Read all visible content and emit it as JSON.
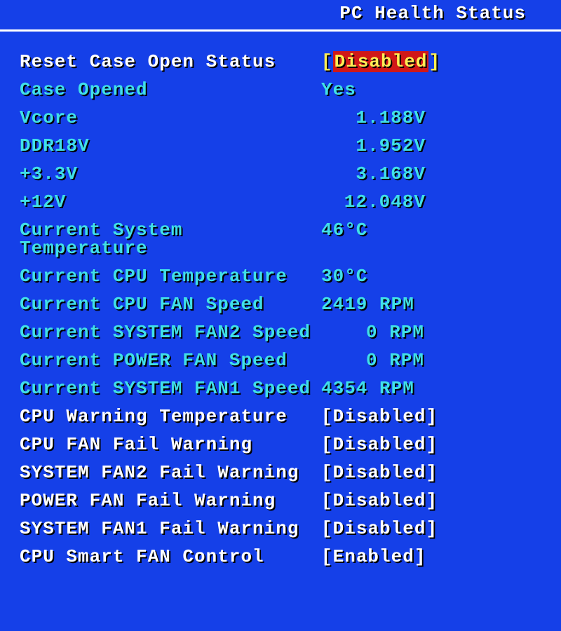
{
  "header": {
    "title": "PC Health Status"
  },
  "rows": [
    {
      "label": "Reset Case Open Status",
      "value": "Disabled",
      "labelClass": "white",
      "valueClass": "yellow",
      "bracketed": true,
      "highlighted": true,
      "interactable": true
    },
    {
      "label": "Case Opened",
      "value": "Yes",
      "labelClass": "cyan",
      "valueClass": "cyan",
      "bracketed": false,
      "interactable": false,
      "align": "left"
    },
    {
      "label": "Vcore",
      "value": "1.188V",
      "labelClass": "cyan",
      "valueClass": "cyan",
      "bracketed": false,
      "interactable": false,
      "align": "right"
    },
    {
      "label": "DDR18V",
      "value": "1.952V",
      "labelClass": "cyan",
      "valueClass": "cyan",
      "bracketed": false,
      "interactable": false,
      "align": "right"
    },
    {
      "label": "+3.3V",
      "value": "3.168V",
      "labelClass": "cyan",
      "valueClass": "cyan",
      "bracketed": false,
      "interactable": false,
      "align": "right"
    },
    {
      "label": "+12V",
      "value": "12.048V",
      "labelClass": "cyan",
      "valueClass": "cyan",
      "bracketed": false,
      "interactable": false,
      "align": "right"
    },
    {
      "label": "Current System Temperature",
      "value": "46°C",
      "labelClass": "cyan",
      "valueClass": "cyan",
      "bracketed": false,
      "interactable": false,
      "align": "left"
    },
    {
      "label": "Current CPU Temperature",
      "value": "30°C",
      "labelClass": "cyan",
      "valueClass": "cyan",
      "bracketed": false,
      "interactable": false,
      "align": "left"
    },
    {
      "label": "Current CPU FAN Speed",
      "value": "2419 RPM",
      "labelClass": "cyan",
      "valueClass": "cyan",
      "bracketed": false,
      "interactable": false,
      "align": "left"
    },
    {
      "label": "Current SYSTEM FAN2 Speed",
      "value": "0 RPM",
      "labelClass": "cyan",
      "valueClass": "cyan",
      "bracketed": false,
      "interactable": false,
      "align": "rpm"
    },
    {
      "label": "Current POWER FAN Speed",
      "value": "0 RPM",
      "labelClass": "cyan",
      "valueClass": "cyan",
      "bracketed": false,
      "interactable": false,
      "align": "rpm"
    },
    {
      "label": "Current SYSTEM FAN1 Speed",
      "value": "4354 RPM",
      "labelClass": "cyan",
      "valueClass": "cyan",
      "bracketed": false,
      "interactable": false,
      "align": "left"
    },
    {
      "label": "CPU Warning Temperature",
      "value": "Disabled",
      "labelClass": "white",
      "valueClass": "white",
      "bracketed": true,
      "interactable": true
    },
    {
      "label": "CPU FAN Fail Warning",
      "value": "Disabled",
      "labelClass": "white",
      "valueClass": "white",
      "bracketed": true,
      "interactable": true
    },
    {
      "label": "SYSTEM FAN2 Fail Warning",
      "value": "Disabled",
      "labelClass": "white",
      "valueClass": "white",
      "bracketed": true,
      "interactable": true
    },
    {
      "label": "POWER FAN Fail Warning",
      "value": "Disabled",
      "labelClass": "white",
      "valueClass": "white",
      "bracketed": true,
      "interactable": true
    },
    {
      "label": "SYSTEM FAN1 Fail Warning",
      "value": "Disabled",
      "labelClass": "white",
      "valueClass": "white",
      "bracketed": true,
      "interactable": true
    },
    {
      "label": "CPU Smart FAN Control",
      "value": "Enabled",
      "labelClass": "white",
      "valueClass": "white",
      "bracketed": true,
      "interactable": true
    }
  ]
}
